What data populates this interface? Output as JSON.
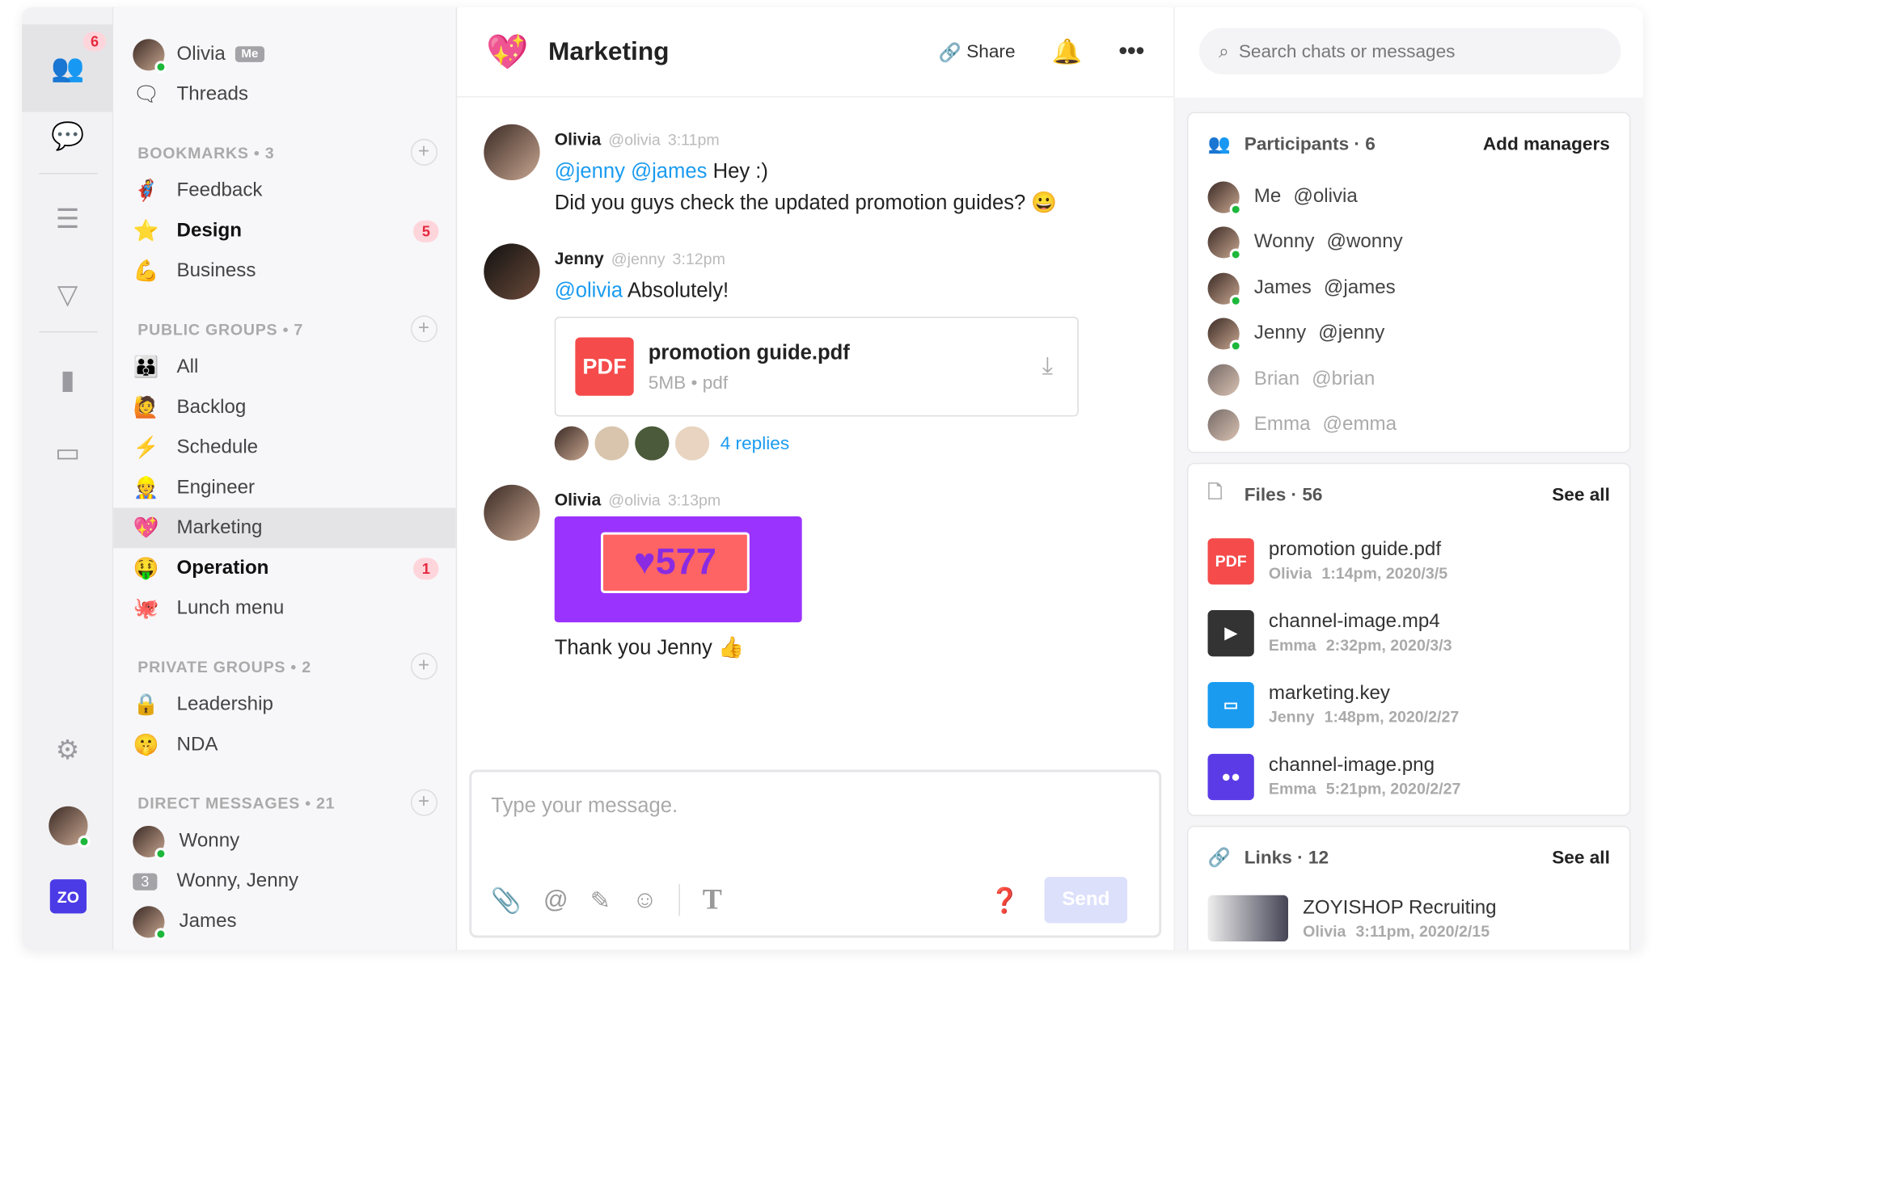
{
  "colors": {
    "accent": "#1a9bf0",
    "brand": "#4b3be6",
    "badge": "#e5283d",
    "online": "#1db83b",
    "pdf": "#f54b4b",
    "image": "#9b33fe"
  },
  "rail": {
    "badge": "6",
    "logo": "ZO",
    "icons": [
      "people-icon",
      "chat-bubble-icon",
      "list-icon",
      "send-icon",
      "bar-chart-icon",
      "bot-icon",
      "gear-icon"
    ]
  },
  "sidebar": {
    "user": {
      "name": "Olivia",
      "tag": "Me"
    },
    "threads": "Threads",
    "bookmarks": {
      "header": "BOOKMARKS • 3",
      "items": [
        {
          "emoji": "🦸",
          "label": "Feedback"
        },
        {
          "emoji": "⭐",
          "label": "Design",
          "badge": "5",
          "bold": true
        },
        {
          "emoji": "💪",
          "label": "Business"
        }
      ]
    },
    "public": {
      "header": "PUBLIC GROUPS • 7",
      "items": [
        {
          "emoji": "👪",
          "label": "All"
        },
        {
          "emoji": "🙋",
          "label": "Backlog"
        },
        {
          "emoji": "⚡",
          "label": "Schedule"
        },
        {
          "emoji": "👷",
          "label": "Engineer"
        },
        {
          "emoji": "💖",
          "label": "Marketing",
          "selected": true
        },
        {
          "emoji": "🤑",
          "label": "Operation",
          "badge": "1",
          "bold": true
        },
        {
          "emoji": "🐙",
          "label": "Lunch menu"
        }
      ]
    },
    "private": {
      "header": "PRIVATE GROUPS • 2",
      "items": [
        {
          "emoji": "🔒",
          "label": "Leadership"
        },
        {
          "emoji": "🤫",
          "label": "NDA"
        }
      ]
    },
    "dms": {
      "header": "DIRECT MESSAGES • 21",
      "items": [
        {
          "label": "Wonny"
        },
        {
          "count": "3",
          "label": "Wonny, Jenny"
        },
        {
          "label": "James"
        }
      ]
    }
  },
  "chat": {
    "emoji": "💖",
    "title": "Marketing",
    "share": "Share",
    "messages": [
      {
        "name": "Olivia",
        "handle": "@olivia",
        "time": "3:11pm",
        "mentions": "@jenny @james",
        "text1": " Hey :)",
        "text2": "Did you guys check the updated promotion guides? 😀"
      },
      {
        "name": "Jenny",
        "handle": "@jenny",
        "time": "3:12pm",
        "mentions": "@olivia",
        "text1": " Absolutely!",
        "file": {
          "type": "PDF",
          "name": "promotion guide.pdf",
          "meta": "5MB • pdf"
        },
        "replies": "4 replies"
      },
      {
        "name": "Olivia",
        "handle": "@olivia",
        "time": "3:13pm",
        "image_text": "♥577",
        "text1": "Thank you Jenny 👍"
      }
    ],
    "composer": {
      "placeholder": "Type your message.",
      "send": "Send"
    }
  },
  "right": {
    "search_placeholder": "Search chats or messages",
    "participants": {
      "title": "Participants · 6",
      "action": "Add managers",
      "items": [
        {
          "name": "Me",
          "handle": "@olivia",
          "online": true
        },
        {
          "name": "Wonny",
          "handle": "@wonny",
          "online": true
        },
        {
          "name": "James",
          "handle": "@james",
          "online": true
        },
        {
          "name": "Jenny",
          "handle": "@jenny",
          "online": true
        },
        {
          "name": "Brian",
          "handle": "@brian",
          "online": false
        },
        {
          "name": "Emma",
          "handle": "@emma",
          "online": false
        }
      ]
    },
    "files": {
      "title": "Files · 56",
      "action": "See all",
      "items": [
        {
          "icon": "PDF",
          "name": "promotion guide.pdf",
          "user": "Olivia",
          "time": "1:14pm, 2020/3/5"
        },
        {
          "icon": "video",
          "name": "channel-image.mp4",
          "user": "Emma",
          "time": "2:32pm, 2020/3/3"
        },
        {
          "icon": "keynote",
          "name": "marketing.key",
          "user": "Jenny",
          "time": "1:48pm, 2020/2/27"
        },
        {
          "icon": "image",
          "name": "channel-image.png",
          "user": "Emma",
          "time": "5:21pm, 2020/2/27"
        }
      ]
    },
    "links": {
      "title": "Links · 12",
      "action": "See all",
      "items": [
        {
          "name": "ZOYISHOP Recruiting",
          "user": "Olivia",
          "time": "3:11pm, 2020/2/15"
        }
      ]
    }
  }
}
